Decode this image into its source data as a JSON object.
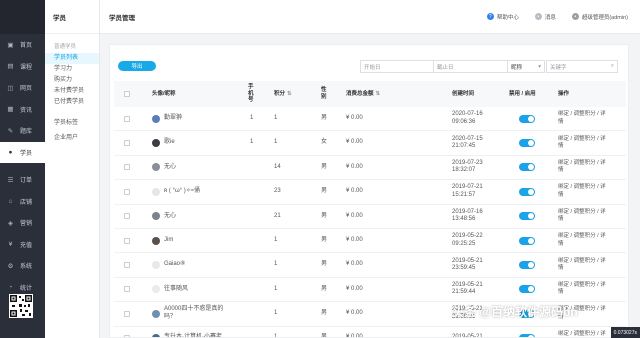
{
  "colors": {
    "accent": "#18a9e8",
    "nav_bg": "#2b2f3a",
    "toggle_on": "#1aa3e6"
  },
  "nav": [
    {
      "label": "首页",
      "icon": "dashboard-icon"
    },
    {
      "label": "课程",
      "icon": "course-icon"
    },
    {
      "label": "网页",
      "icon": "web-icon"
    },
    {
      "label": "资讯",
      "icon": "news-icon"
    },
    {
      "label": "题库",
      "icon": "question-bank-icon"
    },
    {
      "label": "学员",
      "icon": "student-icon"
    },
    {
      "label": "订单",
      "icon": "order-icon"
    },
    {
      "label": "店铺",
      "icon": "shop-icon"
    },
    {
      "label": "营销",
      "icon": "marketing-icon"
    },
    {
      "label": "充值",
      "icon": "recharge-icon"
    },
    {
      "label": "系统",
      "icon": "system-icon"
    },
    {
      "label": "统计",
      "icon": "statistics-icon"
    }
  ],
  "subnav": {
    "title": "学员",
    "group": "普通学员",
    "items": [
      "学员列表",
      "学习力",
      "购买力",
      "未付费学员",
      "已付费学员"
    ],
    "items2": [
      "学员标签",
      "企业用户"
    ]
  },
  "topbar": {
    "crumb": "学员管理",
    "help": "帮助中心",
    "messages": "消息",
    "user": "超级管理员(admin)"
  },
  "toolbar": {
    "export": "导出",
    "start_date": "开始日",
    "end_date": "截止日",
    "field_select": "昵称",
    "keyword": "关键字"
  },
  "columns": {
    "avatar_name": "头像/昵称",
    "phone": "手机号",
    "points": "积分",
    "gender": "性别",
    "spent": "消费总金额",
    "created": "创建时间",
    "status": "禁用 / 启用",
    "ops": "操作"
  },
  "rows": [
    {
      "name": "勤翠翀",
      "phone": "1",
      "points": "1",
      "gender": "男",
      "spent": "¥ 0.00",
      "date": "2020-07-16",
      "time": "09:06:36",
      "avatar_color": "#5b7db8"
    },
    {
      "name": "歌ie",
      "phone": "1",
      "points": "1",
      "gender": "女",
      "spent": "¥ 0.00",
      "date": "2020-07-15",
      "time": "21:07:45",
      "avatar_color": "#3c3c44"
    },
    {
      "name": "无心",
      "phone": "",
      "points": "14",
      "gender": "男",
      "spent": "¥ 0.00",
      "date": "2019-07-23",
      "time": "18:32:07",
      "avatar_color": "#8a8f99"
    },
    {
      "name": "ʀ ( °ω° )✧≈俑",
      "phone": "",
      "points": "23",
      "gender": "男",
      "spent": "¥ 0.00",
      "date": "2019-07-21",
      "time": "15:21:57",
      "avatar_color": "#e3e6ea"
    },
    {
      "name": "无心",
      "phone": "",
      "points": "21",
      "gender": "男",
      "spent": "¥ 0.00",
      "date": "2019-07-16",
      "time": "13:48:56",
      "avatar_color": "#7d838c"
    },
    {
      "name": "Jim",
      "phone": "",
      "points": "1",
      "gender": "男",
      "spent": "¥ 0.00",
      "date": "2019-05-22",
      "time": "09:25:25",
      "avatar_color": "#5a4f4a"
    },
    {
      "name": "Gaiao⑧",
      "phone": "",
      "points": "1",
      "gender": "男",
      "spent": "¥ 0.00",
      "date": "2019-05-21",
      "time": "23:59:45",
      "avatar_color": "#e6e8eb"
    },
    {
      "name": "往事随风",
      "phone": "",
      "points": "1",
      "gender": "男",
      "spent": "¥ 0.00",
      "date": "2019-05-21",
      "time": "21:59:44",
      "avatar_color": "#e9ebee"
    },
    {
      "name": "A0000四十不惑是真的吗？",
      "phone": "",
      "points": "1",
      "gender": "男",
      "spent": "¥ 0.00",
      "date": "2019-05-21",
      "time": "21:59:21",
      "avatar_color": "#6f8fb0"
    },
    {
      "name": "专升本·计算机·小蹇老",
      "phone": "",
      "points": "1",
      "gender": "男",
      "spent": "¥ 0.00",
      "date": "2019-05-21",
      "time": "",
      "avatar_color": "#4c6a8c"
    }
  ],
  "ops": {
    "line1": "绑定 / 调整积分 / 详",
    "line2": "情"
  },
  "watermark": "头条 @百纳软件源码bn",
  "corner_text": "0.073027s"
}
